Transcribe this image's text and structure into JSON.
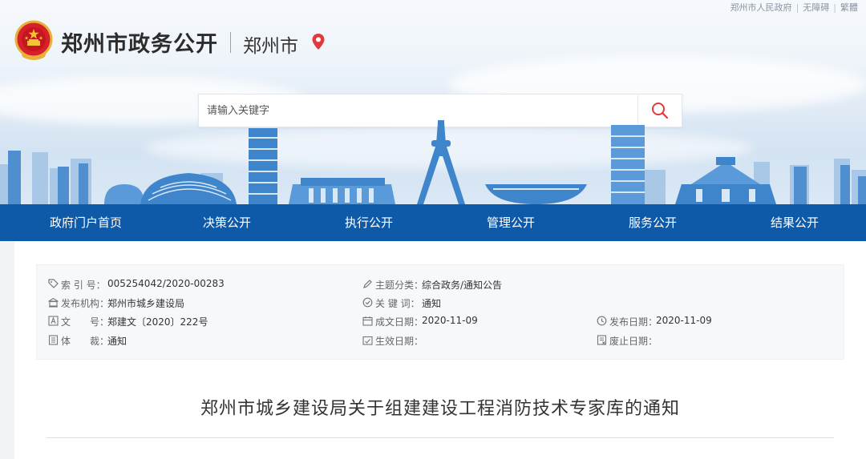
{
  "top_links": [
    "郑州市人民政府",
    "无障碍",
    "繁體"
  ],
  "header": {
    "site_title": "郑州市政务公开",
    "city_name": "郑州市"
  },
  "search": {
    "placeholder": "请输入关键字"
  },
  "nav": [
    "政府门户首页",
    "决策公开",
    "执行公开",
    "管理公开",
    "服务公开",
    "结果公开"
  ],
  "meta": {
    "index_label": "索 引 号：",
    "index_value": "005254042/2020-00283",
    "topic_label": "主题分类：",
    "topic_value": "综合政务/通知公告",
    "publisher_label": "发布机构：",
    "publisher_value": "郑州市城乡建设局",
    "keyword_label": "关 键 词：",
    "keyword_value": "通知",
    "docno_label": "文　　号：",
    "docno_value": "郑建文〔2020〕222号",
    "written_label": "成文日期：",
    "written_value": "2020-11-09",
    "pubdate_label": "发布日期：",
    "pubdate_value": "2020-11-09",
    "genre_label": "体　　裁：",
    "genre_value": "通知",
    "effective_label": "生效日期：",
    "effective_value": "",
    "expiry_label": "废止日期：",
    "expiry_value": ""
  },
  "article": {
    "title": "郑州市城乡建设局关于组建建设工程消防技术专家库的通知"
  },
  "colors": {
    "nav_bg": "#0f5aa8",
    "accent_red": "#d8202a",
    "skyline_blue": "#4f8fd0"
  }
}
